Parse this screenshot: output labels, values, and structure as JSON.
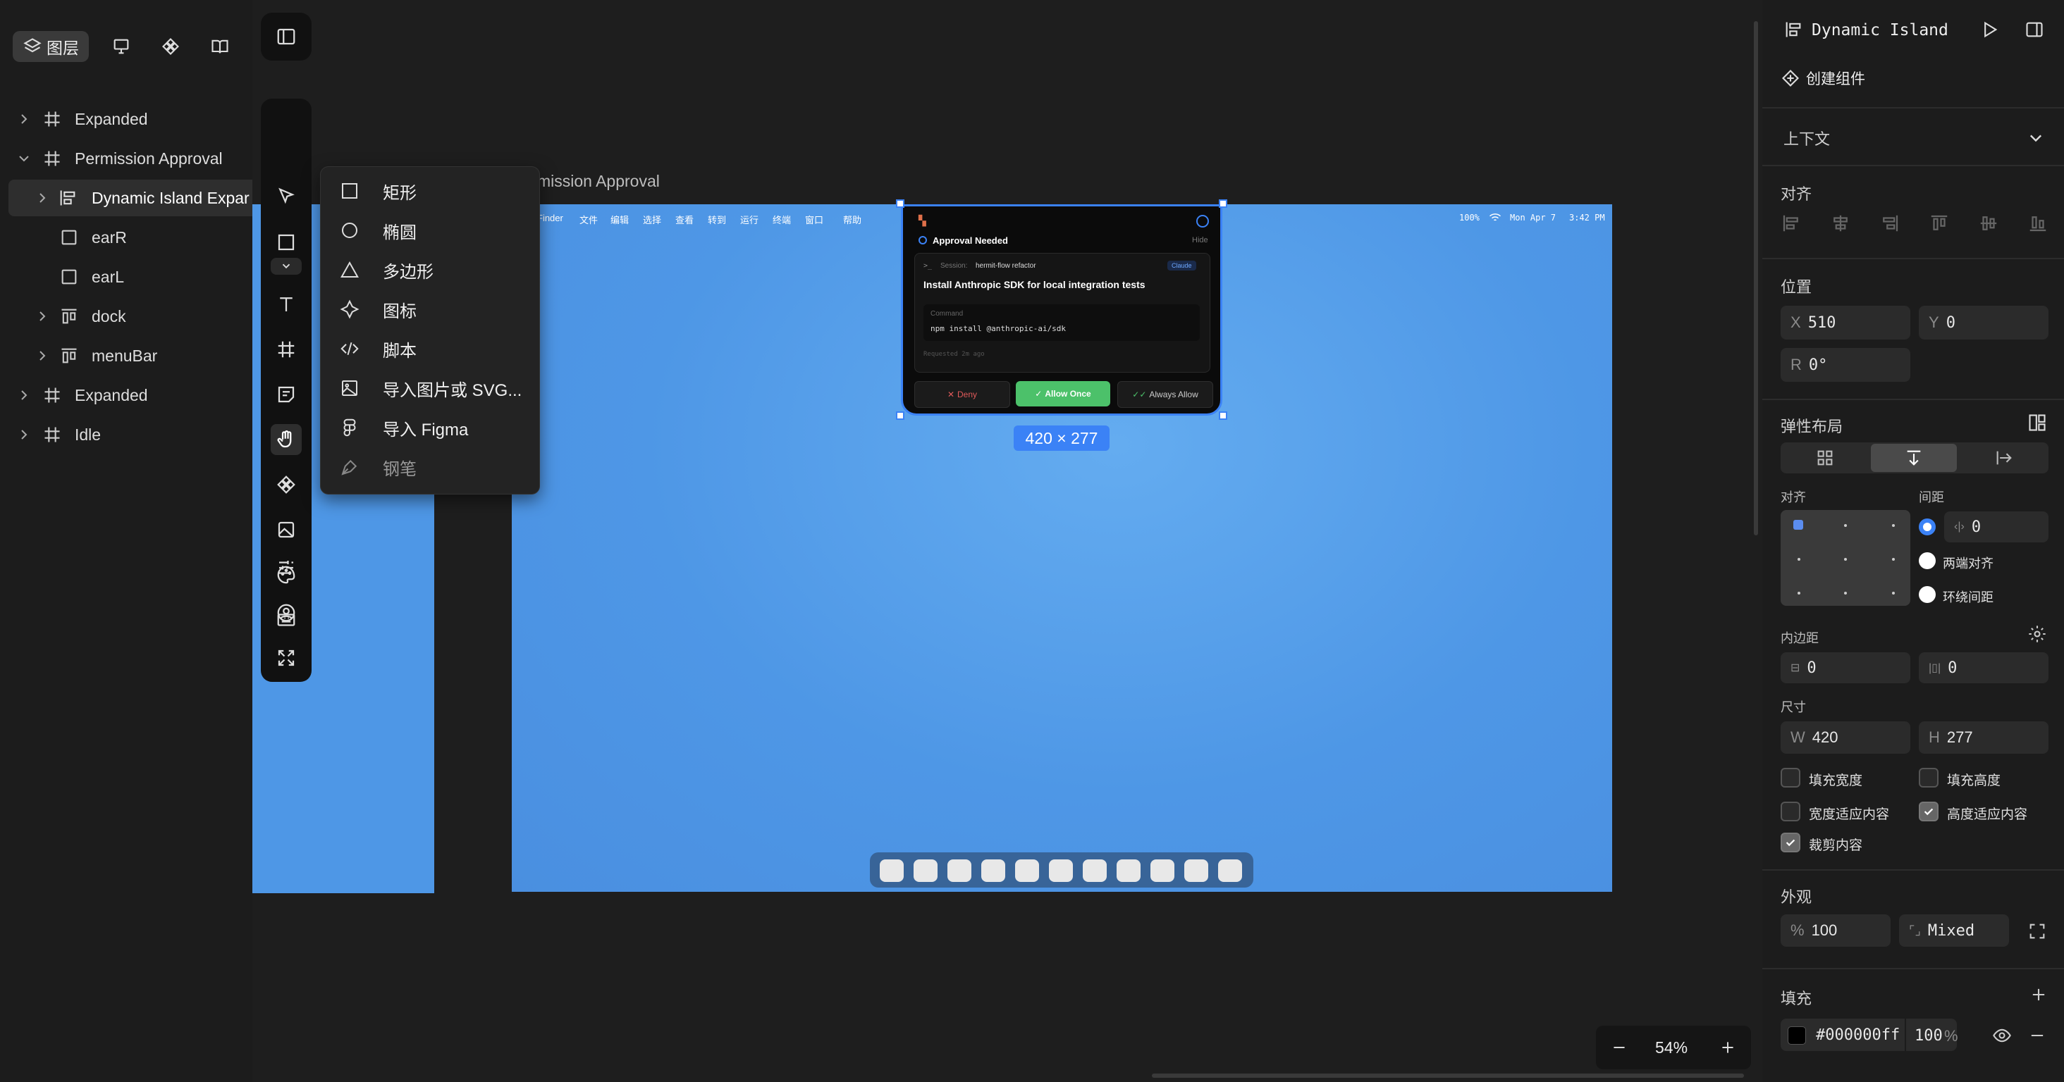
{
  "left_panel": {
    "tabs": [
      {
        "icon": "layers-icon",
        "label": "图层"
      },
      {
        "icon": "presentation-icon",
        "label": ""
      },
      {
        "icon": "component-icon",
        "label": ""
      },
      {
        "icon": "book-icon",
        "label": ""
      }
    ],
    "layers": [
      {
        "name": "Expanded",
        "icon": "frame-icon",
        "expanded": false
      },
      {
        "name": "Permission Approval",
        "icon": "frame-icon",
        "expanded": true
      },
      {
        "name": "Dynamic Island Expar",
        "icon": "stack-layout-icon",
        "expanded": false,
        "selected": true
      },
      {
        "name": "earR",
        "icon": "rectangle-icon"
      },
      {
        "name": "earL",
        "icon": "rectangle-icon"
      },
      {
        "name": "dock",
        "icon": "row-layout-icon",
        "expanded": false
      },
      {
        "name": "menuBar",
        "icon": "row-layout-icon",
        "expanded": false
      },
      {
        "name": "Expanded",
        "icon": "frame-icon",
        "expanded": false
      },
      {
        "name": "Idle",
        "icon": "frame-icon",
        "expanded": false
      }
    ]
  },
  "toolbar": {
    "tools": [
      "sidebar-toggle-icon",
      "pointer-icon",
      "rectangle-tool-icon",
      "more-shapes-chevron-icon",
      "text-tool-icon",
      "frame-tool-icon",
      "note-icon",
      "hand-tool-icon",
      "component-tool-icon",
      "image-tool-icon",
      "palette-icon",
      "keyboard-icon",
      "sliders-icon",
      "user-circle-icon",
      "fullscreen-icon"
    ]
  },
  "shape_menu": {
    "items": [
      {
        "icon": "rectangle-icon",
        "label": "矩形"
      },
      {
        "icon": "ellipse-icon",
        "label": "椭圆"
      },
      {
        "icon": "polygon-icon",
        "label": "多边形"
      },
      {
        "icon": "star-icon",
        "label": "图标"
      },
      {
        "icon": "code-icon",
        "label": "脚本"
      },
      {
        "icon": "image-icon",
        "label": "导入图片或 SVG..."
      },
      {
        "icon": "figma-icon",
        "label": "导入 Figma"
      },
      {
        "icon": "pen-icon",
        "label": "钢笔",
        "disabled": true
      }
    ]
  },
  "canvas": {
    "frame_label": "mission Approval",
    "selection_size": "420 × 277",
    "menubar": {
      "items": [
        "Finder",
        "文件",
        "编辑",
        "选择",
        "查看",
        "转到",
        "运行",
        "终端",
        "窗口",
        "帮助"
      ],
      "right_items": [
        "100%",
        "Mon Apr 7",
        "3:42 PM"
      ]
    },
    "approval_card": {
      "title": "Approval Needed",
      "hide": "Hide",
      "session_label": "Session:",
      "session_value": "hermit-flow refactor",
      "badge": "Claude",
      "task": "Install Anthropic SDK for local integration tests",
      "command_label": "Command",
      "command": "npm install @anthropic-ai/sdk",
      "requested": "Requested 2m ago",
      "deny": "Deny",
      "allow_once": "Allow Once",
      "always_allow": "Always Allow"
    },
    "dock_icon_count": 11,
    "colors": {
      "desktop": "#4e97e6",
      "allow": "#4cc16a",
      "deny": "#e05a5a",
      "selection": "#3b82f6"
    }
  },
  "zoom": {
    "value": "54%"
  },
  "right_panel": {
    "title": "Dynamic Island",
    "create_component": "创建组件",
    "context": "上下文",
    "align_title": "对齐",
    "position_title": "位置",
    "x": {
      "label": "X",
      "value": "510"
    },
    "y": {
      "label": "Y",
      "value": "0"
    },
    "rotation": {
      "label": "R",
      "value": "0°"
    },
    "flex_title": "弹性布局",
    "flex_align_label": "对齐",
    "gap_label": "间距",
    "gap_value": "0",
    "space_between": "两端对齐",
    "space_around": "环绕间距",
    "padding_title": "内边距",
    "padding_v": "0",
    "padding_h": "0",
    "size_title": "尺寸",
    "w": {
      "label": "W",
      "value": "420"
    },
    "h": {
      "label": "H",
      "value": "277"
    },
    "checkboxes": [
      {
        "label": "填充宽度",
        "checked": false
      },
      {
        "label": "填充高度",
        "checked": false
      },
      {
        "label": "宽度适应内容",
        "checked": false
      },
      {
        "label": "高度适应内容",
        "checked": true
      },
      {
        "label": "裁剪内容",
        "checked": true
      }
    ],
    "appearance_title": "外观",
    "opacity_label": "%",
    "opacity": "100",
    "radius": "Mixed",
    "fill_title": "填充",
    "fill_hex": "#000000ff",
    "fill_opacity": "100",
    "fill_opacity_unit": "%"
  }
}
